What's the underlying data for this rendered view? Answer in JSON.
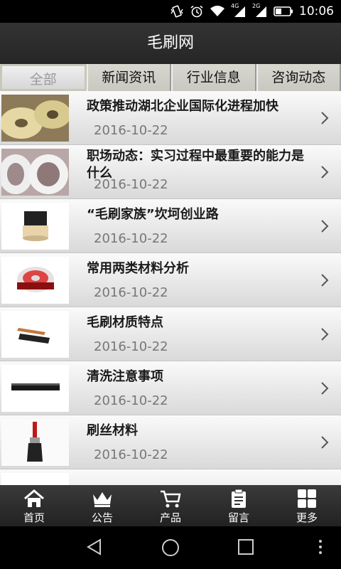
{
  "status_bar": {
    "time": "10:06",
    "network_1": "4G",
    "network_2": "2G",
    "icons": [
      "vibrate-icon",
      "alarm-icon",
      "wifi-icon",
      "signal-icon",
      "signal-icon",
      "battery-icon"
    ]
  },
  "app": {
    "title": "毛刷网"
  },
  "tabs": [
    {
      "label": "全部",
      "active": true
    },
    {
      "label": "新闻资讯",
      "active": false
    },
    {
      "label": "行业信息",
      "active": false
    },
    {
      "label": "咨询动态",
      "active": false
    }
  ],
  "articles": [
    {
      "title": "政策推动湖北企业国际化进程加快",
      "date": "2016-10-22",
      "thumb": "round-brushes-photo"
    },
    {
      "title": "职场动态：实习过程中最重要的能力是什么",
      "date": "2016-10-22",
      "thumb": "brush-rings-photo"
    },
    {
      "title": "“毛刷家族”坎坷创业路",
      "date": "2016-10-22",
      "thumb": "cylinder-brush-photo"
    },
    {
      "title": "常用两类材料分析",
      "date": "2016-10-22",
      "thumb": "disc-brush-photo"
    },
    {
      "title": "毛刷材质特点",
      "date": "2016-10-22",
      "thumb": "hand-brush-photo"
    },
    {
      "title": "清洗注意事项",
      "date": "2016-10-22",
      "thumb": "strip-brush-photo"
    },
    {
      "title": "刷丝材料",
      "date": "2016-10-22",
      "thumb": "paint-brush-photo"
    }
  ],
  "bottom_nav": [
    {
      "label": "首页",
      "icon": "home-icon"
    },
    {
      "label": "公告",
      "icon": "crown-icon"
    },
    {
      "label": "产品",
      "icon": "cart-icon"
    },
    {
      "label": "留言",
      "icon": "clipboard-icon"
    },
    {
      "label": "更多",
      "icon": "grid-icon"
    }
  ],
  "system_nav": [
    "back-icon",
    "home-circle-icon",
    "recents-icon",
    "menu-dots-icon"
  ]
}
